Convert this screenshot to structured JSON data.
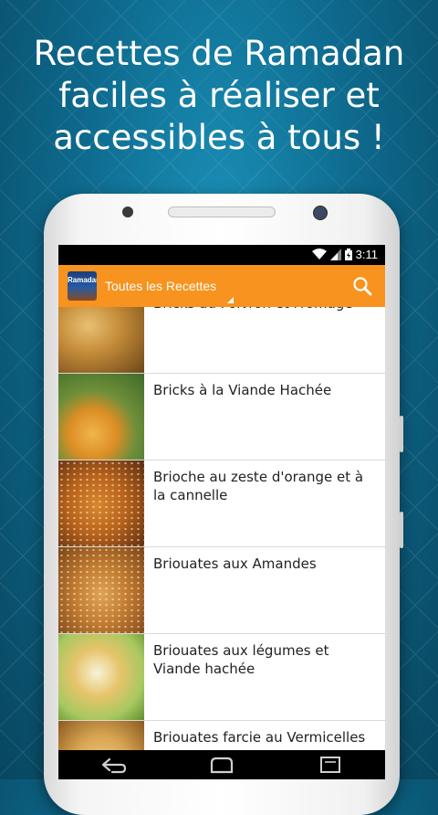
{
  "promo": {
    "line1": "Recettes de Ramadan",
    "line2": "faciles à réaliser et",
    "line3": "accessibles à tous !"
  },
  "statusbar": {
    "time": "3:11",
    "icons": [
      "wifi-icon",
      "signal-icon",
      "battery-icon"
    ]
  },
  "appbar": {
    "logo_text": "Ramadan",
    "title": "Toutes les Recettes",
    "search_icon": "search-icon"
  },
  "recipes": [
    {
      "title": "Bricks au Poivron et Fromage"
    },
    {
      "title": "Bricks à la Viande Hachée"
    },
    {
      "title": "Brioche au zeste d'orange et à la cannelle"
    },
    {
      "title": "Briouates aux Amandes"
    },
    {
      "title": "Briouates aux légumes et Viande hachée"
    },
    {
      "title": "Briouates farcie au Vermicelles"
    }
  ],
  "navbar": [
    "back-icon",
    "home-icon",
    "recents-icon"
  ],
  "colors": {
    "accent": "#f7931e",
    "background": "#0e6a8e"
  }
}
